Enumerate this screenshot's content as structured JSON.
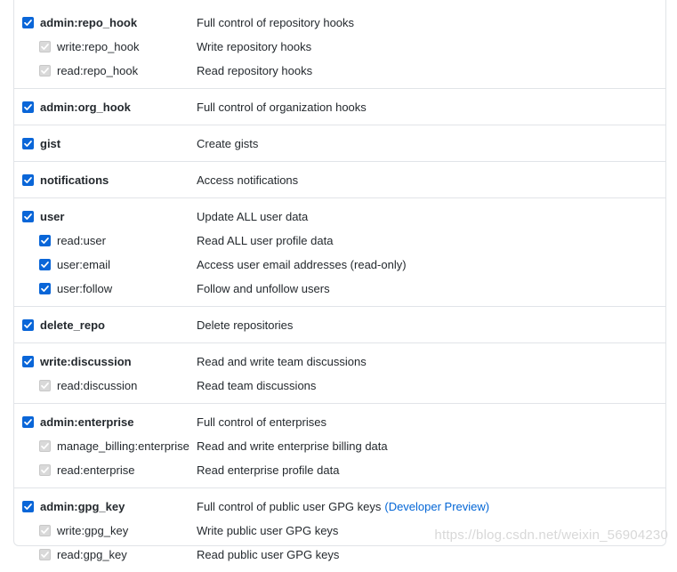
{
  "scopes": [
    {
      "name": "admin:repo_hook",
      "desc": "Full control of repository hooks",
      "checked": true,
      "children": [
        {
          "name": "write:repo_hook",
          "desc": "Write repository hooks",
          "state": "disabled"
        },
        {
          "name": "read:repo_hook",
          "desc": "Read repository hooks",
          "state": "disabled"
        }
      ]
    },
    {
      "name": "admin:org_hook",
      "desc": "Full control of organization hooks",
      "checked": true,
      "children": []
    },
    {
      "name": "gist",
      "desc": "Create gists",
      "checked": true,
      "children": []
    },
    {
      "name": "notifications",
      "desc": "Access notifications",
      "checked": true,
      "children": []
    },
    {
      "name": "user",
      "desc": "Update ALL user data",
      "checked": true,
      "children": [
        {
          "name": "read:user",
          "desc": "Read ALL user profile data",
          "state": "checked"
        },
        {
          "name": "user:email",
          "desc": "Access user email addresses (read-only)",
          "state": "checked"
        },
        {
          "name": "user:follow",
          "desc": "Follow and unfollow users",
          "state": "checked"
        }
      ]
    },
    {
      "name": "delete_repo",
      "desc": "Delete repositories",
      "checked": true,
      "children": []
    },
    {
      "name": "write:discussion",
      "desc": "Read and write team discussions",
      "checked": true,
      "children": [
        {
          "name": "read:discussion",
          "desc": "Read team discussions",
          "state": "disabled"
        }
      ]
    },
    {
      "name": "admin:enterprise",
      "desc": "Full control of enterprises",
      "checked": true,
      "children": [
        {
          "name": "manage_billing:enterprise",
          "desc": "Read and write enterprise billing data",
          "state": "disabled"
        },
        {
          "name": "read:enterprise",
          "desc": "Read enterprise profile data",
          "state": "disabled"
        }
      ]
    },
    {
      "name": "admin:gpg_key",
      "desc": "Full control of public user GPG keys",
      "link": "(Developer Preview)",
      "checked": true,
      "children": [
        {
          "name": "write:gpg_key",
          "desc": "Write public user GPG keys",
          "state": "disabled"
        },
        {
          "name": "read:gpg_key",
          "desc": "Read public user GPG keys",
          "state": "disabled"
        }
      ]
    }
  ],
  "watermark": "https://blog.csdn.net/weixin_56904230",
  "colors": {
    "checkbox_checked": "#0a66d8",
    "checkbox_disabled": "#d9d9d9",
    "link": "#0366d6"
  }
}
